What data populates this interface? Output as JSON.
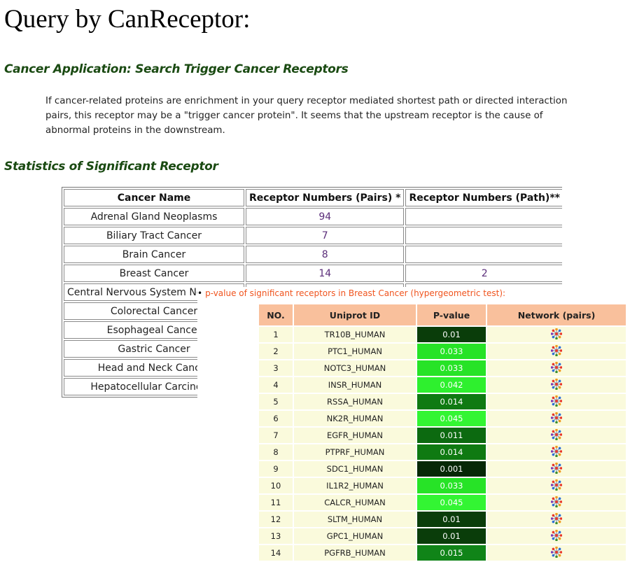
{
  "page": {
    "title": "Query by CanReceptor:",
    "section1_title": "Cancer Application: Search Trigger Cancer Receptors",
    "intro": "If cancer-related proteins are enrichment in your query receptor mediated shortest path or directed interaction pairs, this receptor may be a \"trigger cancer protein\". It seems that the upstream receptor is the cause of abnormal proteins in the downstream.",
    "section2_title": "Statistics of Significant Receptor"
  },
  "stats_table": {
    "headers": [
      "Cancer Name",
      "Receptor Numbers (Pairs) *",
      "Receptor Numbers (Path)**"
    ],
    "rows": [
      {
        "name": "Adrenal Gland Neoplasms",
        "pairs": "94",
        "path": ""
      },
      {
        "name": "Biliary Tract Cancer",
        "pairs": "7",
        "path": ""
      },
      {
        "name": "Brain Cancer",
        "pairs": "8",
        "path": ""
      },
      {
        "name": "Breast Cancer",
        "pairs": "14",
        "path": "2"
      },
      {
        "name": "Central Nervous System Neoplasms",
        "pairs": "",
        "path": ""
      },
      {
        "name": "Colorectal Cancer",
        "pairs": "",
        "path": ""
      },
      {
        "name": "Esophageal Cancer",
        "pairs": "",
        "path": ""
      },
      {
        "name": "Gastric Cancer",
        "pairs": "",
        "path": ""
      },
      {
        "name": "Head and Neck Cancer",
        "pairs": "",
        "path": ""
      },
      {
        "name": "Hepatocellular Carcinoma",
        "pairs": "",
        "path": ""
      }
    ]
  },
  "popup": {
    "bullet": "•",
    "title": "p-value of significant receptors in Breast Cancer (hypergeometric test):",
    "headers": [
      "NO.",
      "Uniprot ID",
      "P-value",
      "Network (pairs)"
    ],
    "network_icon": "network-star-icon",
    "rows": [
      {
        "no": "1",
        "id": "TR10B_HUMAN",
        "p": "0.01",
        "color": "#0a3d0a"
      },
      {
        "no": "2",
        "id": "PTC1_HUMAN",
        "p": "0.033",
        "color": "#27e327"
      },
      {
        "no": "3",
        "id": "NOTC3_HUMAN",
        "p": "0.033",
        "color": "#27e327"
      },
      {
        "no": "4",
        "id": "INSR_HUMAN",
        "p": "0.042",
        "color": "#2ef02e"
      },
      {
        "no": "5",
        "id": "RSSA_HUMAN",
        "p": "0.014",
        "color": "#0f7a12"
      },
      {
        "no": "6",
        "id": "NK2R_HUMAN",
        "p": "0.045",
        "color": "#33f533"
      },
      {
        "no": "7",
        "id": "EGFR_HUMAN",
        "p": "0.011",
        "color": "#0c6a10"
      },
      {
        "no": "8",
        "id": "PTPRF_HUMAN",
        "p": "0.014",
        "color": "#0f7a12"
      },
      {
        "no": "9",
        "id": "SDC1_HUMAN",
        "p": "0.001",
        "color": "#062806"
      },
      {
        "no": "10",
        "id": "IL1R2_HUMAN",
        "p": "0.033",
        "color": "#27e327"
      },
      {
        "no": "11",
        "id": "CALCR_HUMAN",
        "p": "0.045",
        "color": "#33f533"
      },
      {
        "no": "12",
        "id": "SLTM_HUMAN",
        "p": "0.01",
        "color": "#0a3d0a"
      },
      {
        "no": "13",
        "id": "GPC1_HUMAN",
        "p": "0.01",
        "color": "#0a3d0a"
      },
      {
        "no": "14",
        "id": "PGFRB_HUMAN",
        "p": "0.015",
        "color": "#108418"
      }
    ]
  }
}
